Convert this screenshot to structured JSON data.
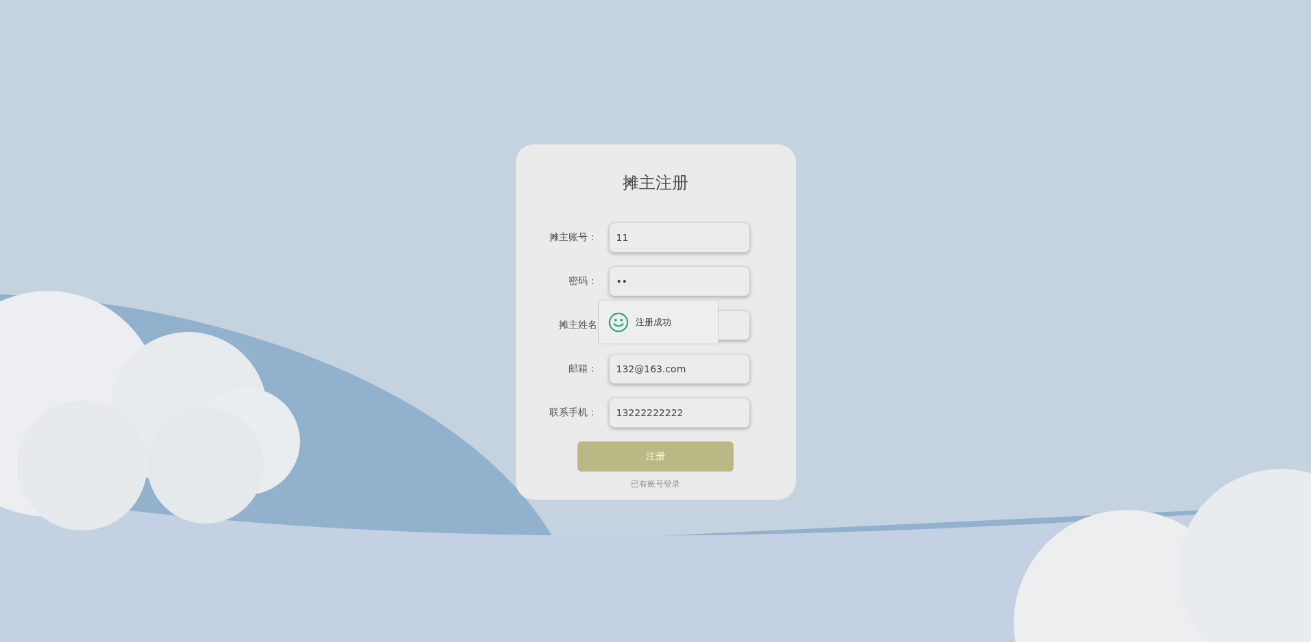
{
  "title": "摊主注册",
  "fields": [
    {
      "label": "摊主账号：",
      "value": "11"
    },
    {
      "label": "密码：",
      "value": "••"
    },
    {
      "label": "摊主姓名"
    },
    {
      "label": "邮箱：",
      "value": "132@163.com"
    },
    {
      "label": "联系手机：",
      "value": "13222222222"
    }
  ],
  "toast": {
    "message": "注册成功"
  },
  "submit_button": "注册",
  "login_link": "已有账号登录"
}
